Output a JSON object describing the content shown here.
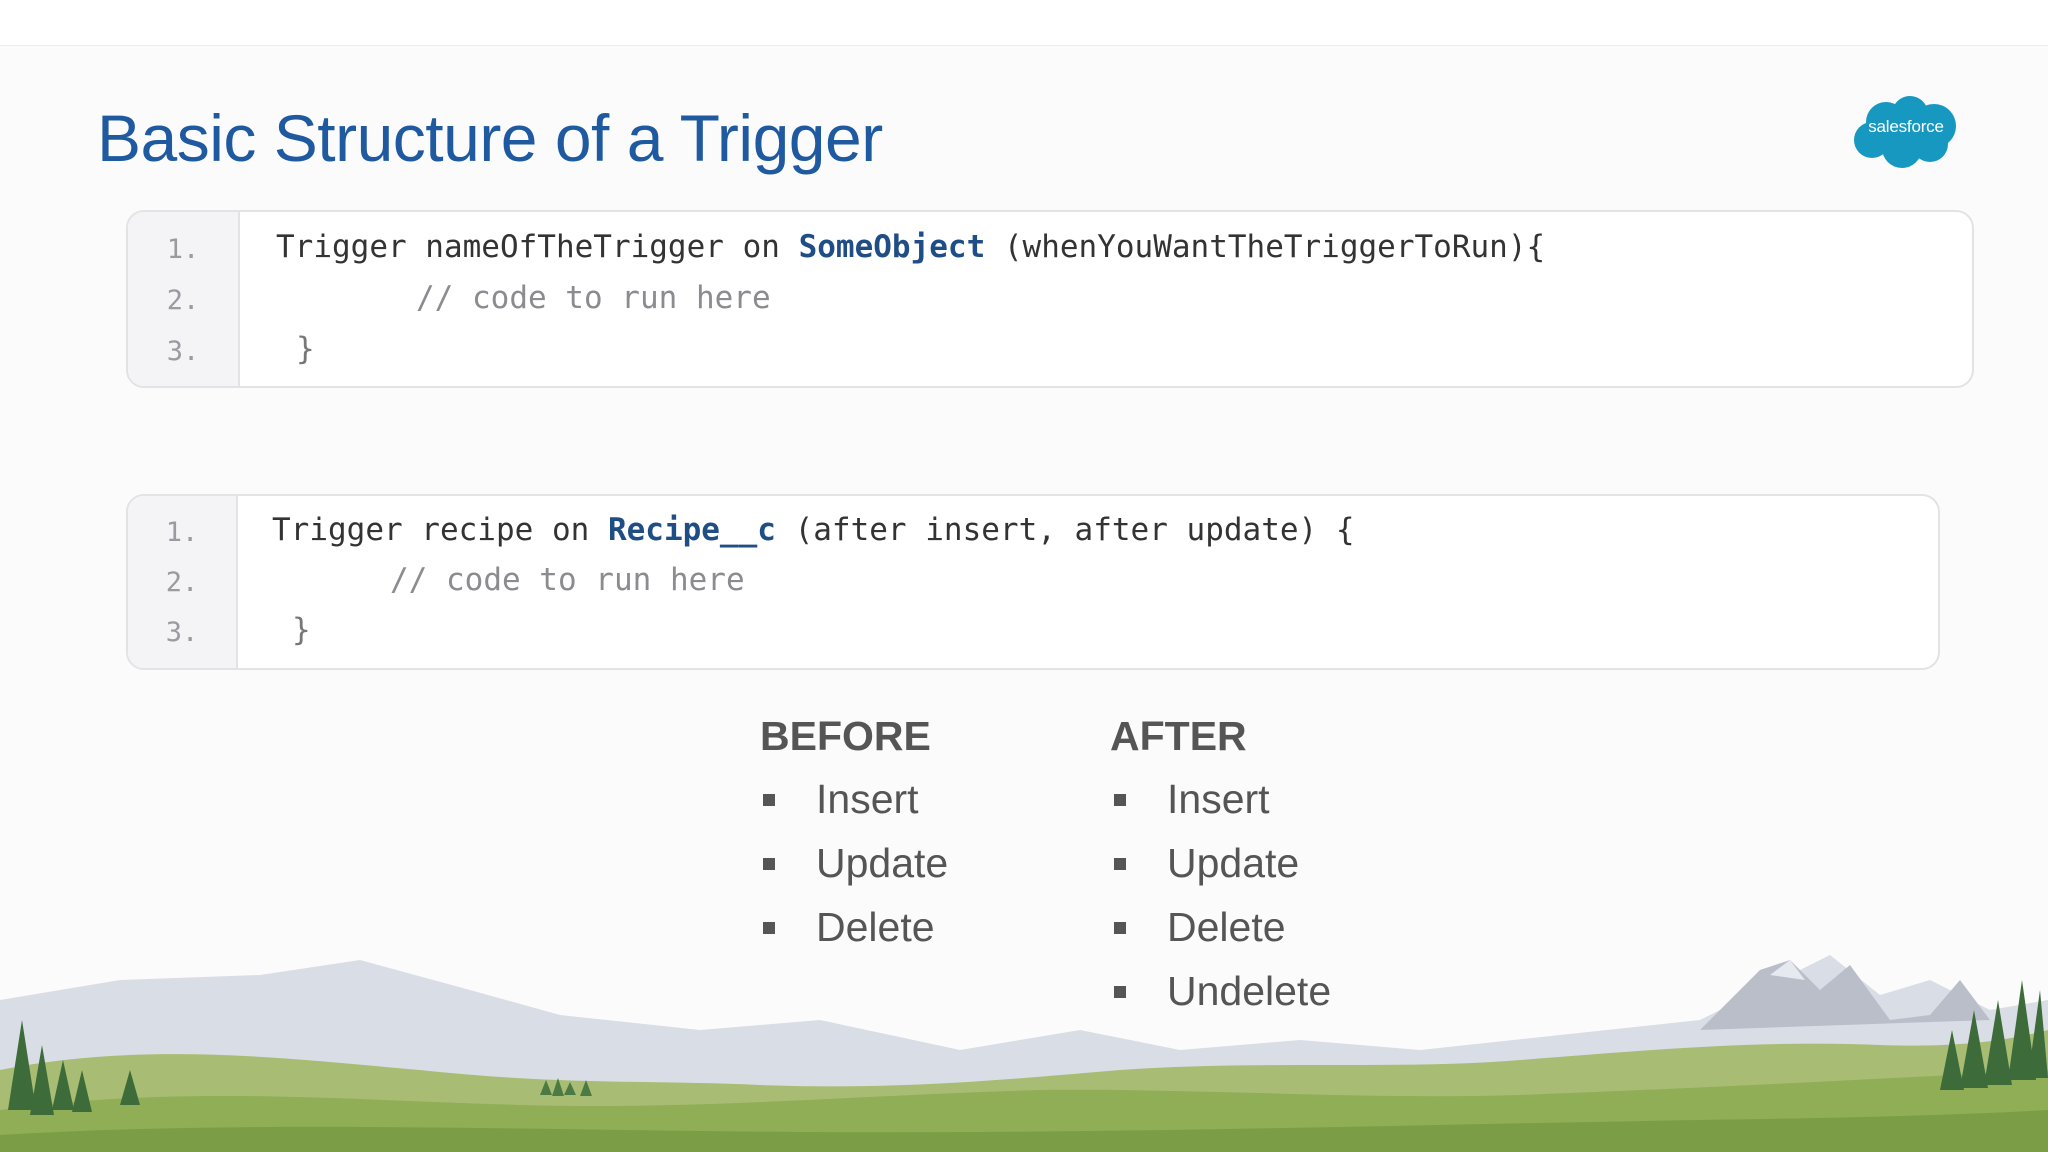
{
  "slide": {
    "title": "Basic Structure of a Trigger",
    "logo_text": "salesforce",
    "colors": {
      "title": "#1f5aa0",
      "logo": "#1798c1",
      "object_highlight": "#1f4e86"
    }
  },
  "code_blocks": [
    {
      "lines": [
        {
          "number": "1.",
          "prefix": "Trigger nameOfTheTrigger on ",
          "object": "SomeObject",
          "suffix": " (whenYouWantTheTriggerToRun){"
        },
        {
          "number": "2.",
          "comment": "// code to run here"
        },
        {
          "number": "3.",
          "brace": "}"
        }
      ]
    },
    {
      "lines": [
        {
          "number": "1.",
          "prefix": "Trigger recipe on ",
          "object": "Recipe__c",
          "suffix": " (after insert, after update) {"
        },
        {
          "number": "2.",
          "comment": "// code to run here"
        },
        {
          "number": "3.",
          "brace": "}"
        }
      ]
    }
  ],
  "lists": {
    "before": {
      "heading": "BEFORE",
      "items": [
        "Insert",
        "Update",
        "Delete"
      ]
    },
    "after": {
      "heading": "AFTER",
      "items": [
        "Insert",
        "Update",
        "Delete",
        "Undelete"
      ]
    }
  }
}
